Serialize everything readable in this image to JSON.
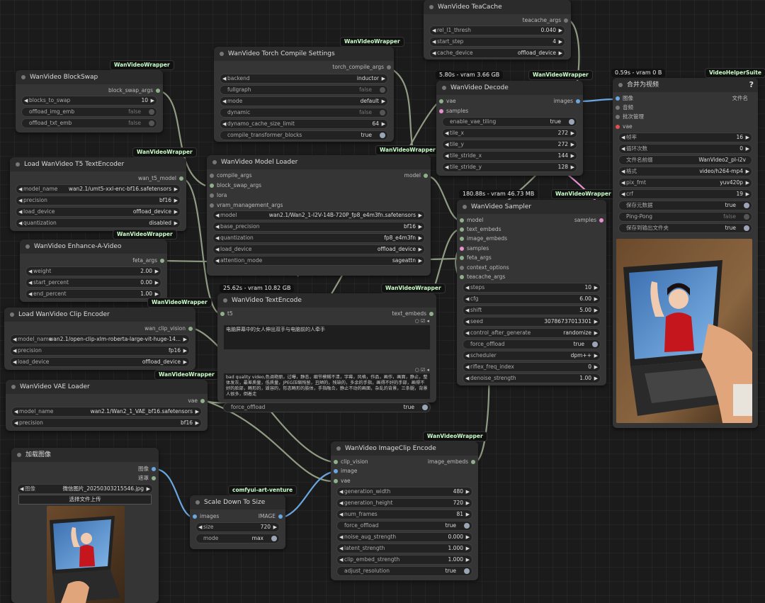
{
  "colors": {
    "canvas": "#1b1b1b",
    "node_body": "#353535",
    "node_header": "#2b2b2b",
    "link": "#8f9b82",
    "link_image": "#6aa7e0",
    "link_latent": "#e890d0"
  },
  "teacache": {
    "title": "WanVideo TeaCache",
    "out": "teacache_args",
    "rel_l1_thresh": {
      "label": "rel_l1_thresh",
      "value": "0.040"
    },
    "start_step": {
      "label": "start_step",
      "value": "4"
    },
    "cache_device": {
      "label": "cache_device",
      "value": "offload_device"
    }
  },
  "compile": {
    "title": "WanVideo Torch Compile Settings",
    "tag": "WanVideoWrapper",
    "out": "torch_compile_args",
    "backend": {
      "label": "backend",
      "value": "inductor"
    },
    "fullgraph": {
      "label": "fullgraph",
      "value": "false"
    },
    "mode": {
      "label": "mode",
      "value": "default"
    },
    "dynamic": {
      "label": "dynamic",
      "value": "false"
    },
    "dynamo_cache_size_limit": {
      "label": "dynamo_cache_size_limit",
      "value": "64"
    },
    "compile_transformer_blocks": {
      "label": "compile_transformer_blocks",
      "value": "true"
    }
  },
  "blockswap": {
    "title": "WanVideo BlockSwap",
    "tag": "WanVideoWrapper",
    "out": "block_swap_args",
    "blocks_to_swap": {
      "label": "blocks_to_swap",
      "value": "10"
    },
    "offload_img_emb": {
      "label": "offload_img_emb",
      "value": "false"
    },
    "offload_txt_emb": {
      "label": "offload_txt_emb",
      "value": "false"
    }
  },
  "t5": {
    "title": "Load WanVideo T5 TextEncoder",
    "tag": "WanVideoWrapper",
    "out": "wan_t5_model",
    "model_name": {
      "label": "model_name",
      "value": "wan2.1/umt5-xxl-enc-bf16.safetensors"
    },
    "precision": {
      "label": "precision",
      "value": "bf16"
    },
    "load_device": {
      "label": "load_device",
      "value": "offload_device"
    },
    "quantization": {
      "label": "quantization",
      "value": "disabled"
    }
  },
  "enhance": {
    "title": "WanVideo Enhance-A-Video",
    "tag": "WanVideoWrapper",
    "out": "feta_args",
    "weight": {
      "label": "weight",
      "value": "2.00"
    },
    "start_percent": {
      "label": "start_percent",
      "value": "0.00"
    },
    "end_percent": {
      "label": "end_percent",
      "value": "1.00"
    }
  },
  "clipenc": {
    "title": "Load WanVideo Clip Encoder",
    "tag": "WanVideoWrapper",
    "out": "wan_clip_vision",
    "model_name": {
      "label": "model_name",
      "value": "wan2.1/open-clip-xlm-roberta-large-vit-huge-14..."
    },
    "precision": {
      "label": "precision",
      "value": "fp16"
    },
    "load_device": {
      "label": "load_device",
      "value": "offload_device"
    }
  },
  "vaeload": {
    "title": "WanVideo VAE Loader",
    "tag": "WanVideoWrapper",
    "out": "vae",
    "model_name": {
      "label": "model_name",
      "value": "wan2.1/Wan2_1_VAE_bf16.safetensors"
    },
    "precision": {
      "label": "precision",
      "value": "bf16"
    }
  },
  "loader": {
    "title": "WanVideo Model Loader",
    "tag": "WanVideoWrapper",
    "inputs": [
      "compile_args",
      "block_swap_args",
      "lora",
      "vram_management_args"
    ],
    "out": "model",
    "model": {
      "label": "model",
      "value": "wan2.1/Wan2_1-I2V-14B-720P_fp8_e4m3fn.safetensors"
    },
    "base_precision": {
      "label": "base_precision",
      "value": "bf16"
    },
    "quantization": {
      "label": "quantization",
      "value": "fp8_e4m3fn"
    },
    "load_device": {
      "label": "load_device",
      "value": "offload_device"
    },
    "attention_mode": {
      "label": "attention_mode",
      "value": "sageattn"
    }
  },
  "textenc": {
    "title": "WanVideo TextEncode",
    "tag": "WanVideoWrapper",
    "stat": "25.62s - vram 10.82 GB",
    "in": "t5",
    "out": "text_embeds",
    "positive": "电脑屏幕中的女人伸出双手与电脑前的人牵手",
    "negative": "bad quality video,色调艳丽，过曝，静态，细节模糊不清，字幕，风格，作品，画作，画面，静止，整体发灰，最差质量，低质量，JPEG压缩残留，丑陋的，残缺的，多余的手指，画得不好的手部，画得不好的脸部，畸形的，毁容的，形态畸形的肢体，手指融合，静止不动的画面，杂乱的背景，三条腿，背景人很多，倒着走",
    "force_offload": {
      "label": "force_offload",
      "value": "true"
    }
  },
  "decode": {
    "title": "WanVideo Decode",
    "tag": "WanVideoWrapper",
    "stat": "5.80s - vram 3.66 GB",
    "inputs": [
      "vae",
      "samples"
    ],
    "out": "images",
    "enable_vae_tiling": {
      "label": "enable_vae_tiling",
      "value": "true"
    },
    "tile_x": {
      "label": "tile_x",
      "value": "272"
    },
    "tile_y": {
      "label": "tile_y",
      "value": "272"
    },
    "tile_stride_x": {
      "label": "tile_stride_x",
      "value": "144"
    },
    "tile_stride_y": {
      "label": "tile_stride_y",
      "value": "128"
    }
  },
  "sampler": {
    "title": "WanVideo Sampler",
    "tag": "WanVideoWrapper",
    "stat": "180.88s - vram 46.73 MB",
    "inputs": [
      "model",
      "text_embeds",
      "image_embeds",
      "samples",
      "feta_args",
      "context_options",
      "teacache_args"
    ],
    "out": "samples",
    "steps": {
      "label": "steps",
      "value": "10"
    },
    "cfg": {
      "label": "cfg",
      "value": "6.00"
    },
    "shift": {
      "label": "shift",
      "value": "5.00"
    },
    "seed": {
      "label": "seed",
      "value": "30786737013301"
    },
    "control_after_generate": {
      "label": "control_after_generate",
      "value": "randomize"
    },
    "force_offload": {
      "label": "force_offload",
      "value": "true"
    },
    "scheduler": {
      "label": "scheduler",
      "value": "dpm++"
    },
    "riflex_freq_index": {
      "label": "riflex_freq_index",
      "value": "0"
    },
    "denoise_strength": {
      "label": "denoise_strength",
      "value": "1.00"
    }
  },
  "combine": {
    "title": "合并为视频",
    "tag": "VideoHelperSuite",
    "stat": "0.59s - vram 0 B",
    "help": "?",
    "inputs": [
      "图像",
      "音频",
      "批次管理",
      "vae"
    ],
    "out": "文件名",
    "frame_rate": {
      "label": "帧率",
      "value": "16"
    },
    "loop_count": {
      "label": "循环次数",
      "value": "0"
    },
    "filename_prefix": {
      "label": "文件名前缀",
      "value": "WanVideo2_pl-i2v"
    },
    "format": {
      "label": "格式",
      "value": "video/h264-mp4"
    },
    "pix_fmt": {
      "label": "pix_fmt",
      "value": "yuv420p"
    },
    "crf": {
      "label": "crf",
      "value": "19"
    },
    "save_metadata": {
      "label": "保存元数据",
      "value": "true"
    },
    "pingpong": {
      "label": "Ping-Pong",
      "value": "false"
    },
    "save_output": {
      "label": "保存到输出文件夹",
      "value": "true"
    }
  },
  "loadimg": {
    "title": "加载图像",
    "outs": [
      "图像",
      "遮罩"
    ],
    "image": {
      "label": "图像",
      "value": "微信图片_20250303215546.jpg"
    },
    "upload": "选择文件上传"
  },
  "scale": {
    "title": "Scale Down To Size",
    "tag": "comfyui-art-venture",
    "in": "images",
    "out": "IMAGE",
    "size": {
      "label": "size",
      "value": "720"
    },
    "mode": {
      "label": "mode",
      "value": "max"
    }
  },
  "imgclip": {
    "title": "WanVideo ImageClip Encode",
    "tag": "WanVideoWrapper",
    "inputs": [
      "clip_vision",
      "image",
      "vae"
    ],
    "out": "image_embeds",
    "generation_width": {
      "label": "generation_width",
      "value": "480"
    },
    "generation_height": {
      "label": "generation_height",
      "value": "720"
    },
    "num_frames": {
      "label": "num_frames",
      "value": "81"
    },
    "force_offload": {
      "label": "force_offload",
      "value": "true"
    },
    "noise_aug_strength": {
      "label": "noise_aug_strength",
      "value": "0.000"
    },
    "latent_strength": {
      "label": "latent_strength",
      "value": "1.000"
    },
    "clip_embed_strength": {
      "label": "clip_embed_strength",
      "value": "1.000"
    },
    "adjust_resolution": {
      "label": "adjust_resolution",
      "value": "true"
    }
  }
}
